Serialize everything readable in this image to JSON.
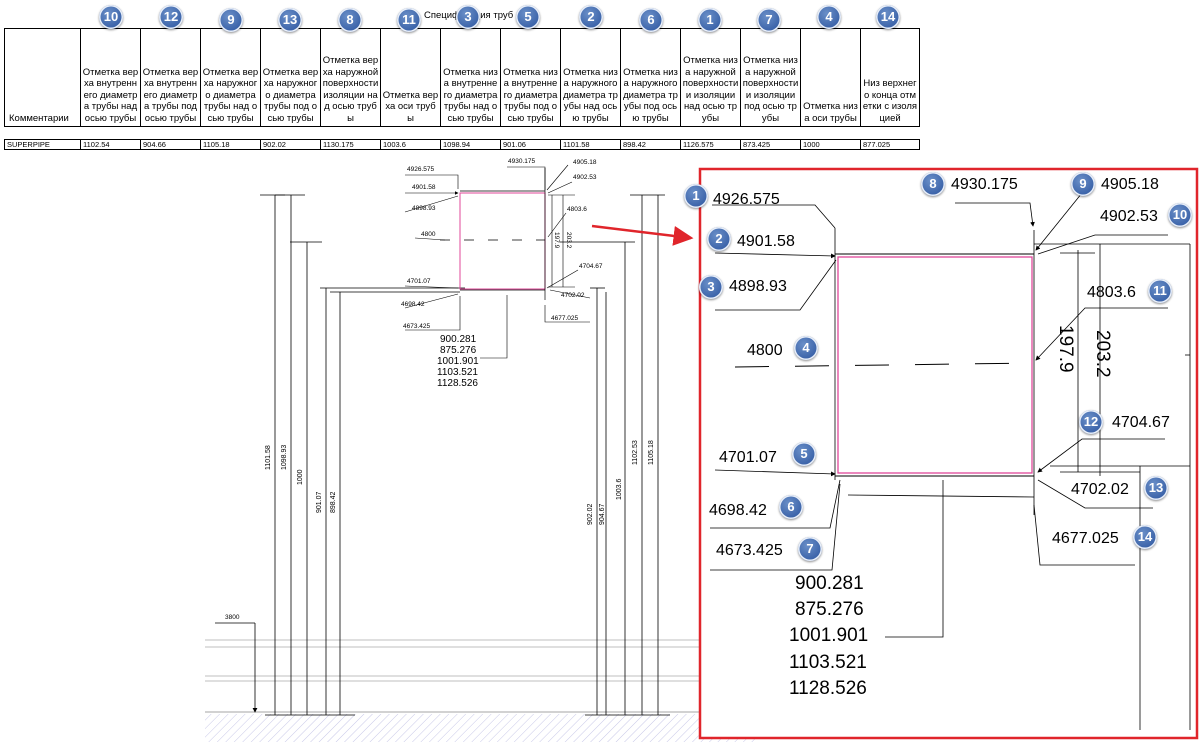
{
  "table": {
    "title": "Спецификация труб",
    "headers": [
      "Комментарии",
      "Отметка верха внутреннего диаметра трубы над осью трубы",
      "Отметка верха внутреннего диаметра трубы под осью трубы",
      "Отметка верха наружного диаметра трубы над осью трубы",
      "Отметка верха наружного диаметра трубы под осью трубы",
      "Отметка верха наружной поверхности изоляции над осью трубы",
      "Отметка верха оси трубы",
      "Отметка низа внутреннего диаметра трубы над осью трубы",
      "Отметка низа внутреннего диаметра трубы под осью трубы",
      "Отметка низа наружного диаметра трубы над осью трубы",
      "Отметка низа наружного диаметра трубы под осью трубы",
      "Отметка низа наружной поверхности и изоляции над осью трубы",
      "Отметка низа наружной поверхности и изоляции под осью трубы",
      "Отметка низа оси трубы",
      "Низ верхнего конца отметки с изоляцией"
    ],
    "badges": [
      "",
      "10",
      "12",
      "9",
      "13",
      "8",
      "11",
      "3",
      "5",
      "2",
      "6",
      "1",
      "7",
      "4",
      "14"
    ],
    "row": [
      "SUPERPIPE",
      "1102.54",
      "904.66",
      "1105.18",
      "902.02",
      "1130.175",
      "1003.6",
      "1098.94",
      "901.06",
      "1101.58",
      "898.42",
      "1126.575",
      "873.425",
      "1000",
      "877.025"
    ]
  },
  "drawing": {
    "small": {
      "e4926_575": "4926.575",
      "e4930_175": "4930.175",
      "e4905_18": "4905.18",
      "e4901_58": "4901.58",
      "e4902_53": "4902.53",
      "e4898_93": "4898.93",
      "e4803_6": "4803.6",
      "e4800": "4800",
      "d197_9": "197.9",
      "d203_2": "203.2",
      "e4704_67": "4704.67",
      "e4701_07": "4701.07",
      "e4702_02": "4702.02",
      "e4698_42": "4698.42",
      "e4677_025": "4677.025",
      "e4673_425": "4673.425",
      "stack": [
        "900.281",
        "875.276",
        "1001.901",
        "1103.521",
        "1128.526"
      ]
    },
    "elevation": {
      "left": [
        "1101.58",
        "1098.93",
        "1000",
        "901.07",
        "898.42"
      ],
      "right": [
        "902.02",
        "904.67",
        "1003.6",
        "1102.53",
        "1105.18"
      ],
      "ground": "3800"
    },
    "zoom": {
      "e4926_575": "4926.575",
      "e4930_175": "4930.175",
      "e4905_18": "4905.18",
      "e4902_53": "4902.53",
      "e4901_58": "4901.58",
      "e4898_93": "4898.93",
      "e4803_6": "4803.6",
      "e4800": "4800",
      "d197_9": "197.9",
      "d203_2": "203.2",
      "e4704_67": "4704.67",
      "e4701_07": "4701.07",
      "e4702_02": "4702.02",
      "e4698_42": "4698.42",
      "e4677_025": "4677.025",
      "e4673_425": "4673.425",
      "stack": [
        "900.281",
        "875.276",
        "1001.901",
        "1103.521",
        "1128.526"
      ],
      "badges": [
        "1",
        "8",
        "9",
        "10",
        "2",
        "3",
        "11",
        "4",
        "12",
        "5",
        "13",
        "6",
        "14",
        "7"
      ]
    }
  },
  "colors": {
    "badge": "#3a62a8",
    "highlight_frame": "#e0252b",
    "pipe_outline": "#e0479a",
    "ground_hatch": "#c8c8e8"
  }
}
